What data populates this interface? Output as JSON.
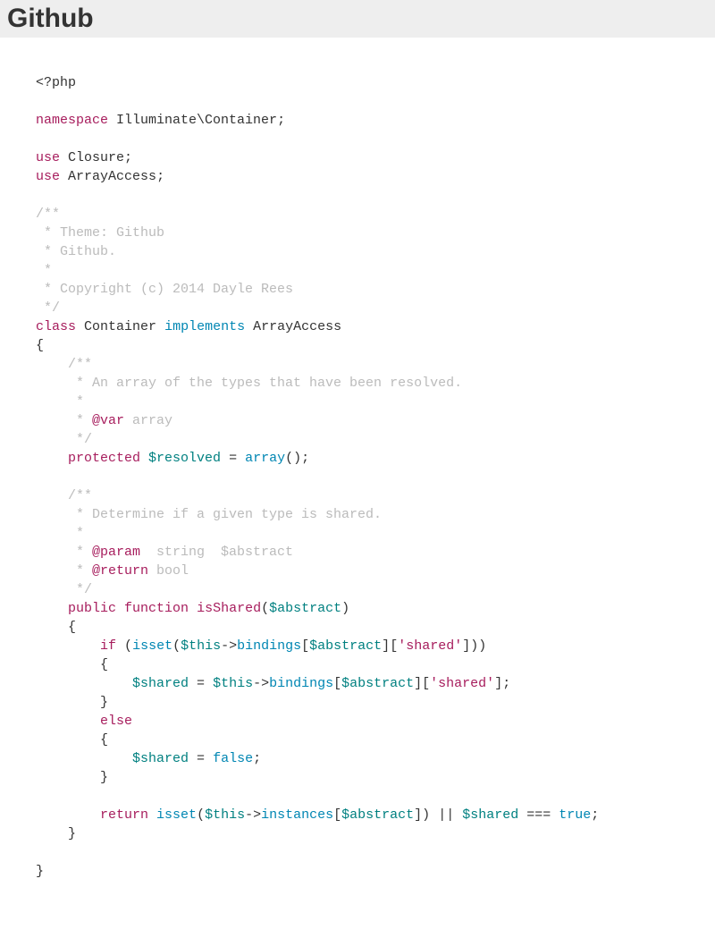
{
  "header": {
    "title": "Github"
  },
  "code": {
    "php_open": "<?php",
    "ns_kw": "namespace",
    "ns_path": "Illuminate\\Container",
    "use_kw": "use",
    "use1": "Closure",
    "use2": "ArrayAccess",
    "doc1_l1": "/**",
    "doc1_l2": " * Theme: Github",
    "doc1_l3": " * Github.",
    "doc1_l4": " *",
    "doc1_l5": " * Copyright (c) 2014 Dayle Rees",
    "doc1_l6": " */",
    "class_kw": "class",
    "class_name": "Container",
    "impl_kw": "implements",
    "impl_name": "ArrayAccess",
    "brace_open": "{",
    "brace_close": "}",
    "doc2_l1": "/**",
    "doc2_l2": " * An array of the types that have been resolved.",
    "doc2_l3": " *",
    "doc2_l4a": " * ",
    "doc2_tag_var": "@var",
    "doc2_type_array": " array",
    "doc2_l5": " */",
    "protected_kw": "protected",
    "resolved_var": "$resolved",
    "eq": " = ",
    "array_kw": "array",
    "empty_parens": "()",
    "semi": ";",
    "doc3_l1": "/**",
    "doc3_l2": " * Determine if a given type is shared.",
    "doc3_l3": " *",
    "doc3_l4a": " * ",
    "doc3_tag_param": "@param",
    "doc3_param_type": "  string  $abstract",
    "doc3_l5a": " * ",
    "doc3_tag_return": "@return",
    "doc3_return_type": " bool",
    "doc3_l6": " */",
    "public_kw": "public",
    "function_kw": "function",
    "fn_name": "isShared",
    "lparen": "(",
    "rparen": ")",
    "abstract_var": "$abstract",
    "if_kw": "if",
    "isset_kw": "isset",
    "this_var": "$this",
    "arrow": "->",
    "bindings": "bindings",
    "lbrack": "[",
    "rbrack": "]",
    "shared_str": "'shared'",
    "shared_var": "$shared",
    "else_kw": "else",
    "false_kw": "false",
    "return_kw": "return",
    "instances": "instances",
    "or_op": " || ",
    "teq": " === ",
    "true_kw": "true",
    "sp": " "
  }
}
